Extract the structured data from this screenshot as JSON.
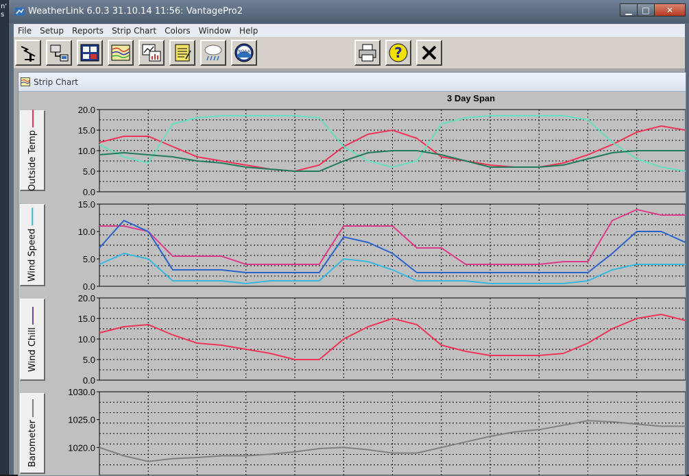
{
  "window": {
    "title": "WeatherLink 6.0.3  31.10.14  11:56: VantagePro2",
    "controls": {
      "minimize": "▁",
      "maximize": "□",
      "close": "✕"
    }
  },
  "desktop": {
    "fragment_text": [
      "n'",
      "s"
    ]
  },
  "menu": [
    "File",
    "Setup",
    "Reports",
    "Strip Chart",
    "Colors",
    "Window",
    "Help"
  ],
  "toolbar": {
    "buttons": [
      {
        "name": "connect-station-icon"
      },
      {
        "name": "download-icon"
      },
      {
        "name": "bulletin-icon"
      },
      {
        "name": "strip-chart-icon"
      },
      {
        "name": "plot-icon"
      },
      {
        "name": "notepad-icon"
      },
      {
        "name": "weather-cloud-icon"
      },
      {
        "name": "noaa-icon",
        "text": "NOAA"
      },
      {
        "name": "print-icon"
      },
      {
        "name": "help-icon",
        "text": "?"
      },
      {
        "name": "close-chart-icon"
      }
    ]
  },
  "child_window": {
    "title": "Strip Chart"
  },
  "chart_data": [
    {
      "type": "line",
      "title": "3 Day Span",
      "ylabel": "Outside Temp",
      "ylim": [
        0,
        20
      ],
      "yticks": [
        "0.0",
        "5.0",
        "10.0",
        "15.0",
        "20.0"
      ],
      "x": [
        0,
        3,
        6,
        9,
        12,
        15,
        18,
        21,
        24,
        27,
        30,
        33,
        36,
        39,
        42,
        45,
        48,
        51,
        54,
        57,
        60,
        63,
        66,
        69,
        72
      ],
      "series": [
        {
          "color": "#ee3355",
          "values": [
            12,
            13.5,
            13.5,
            11,
            8.5,
            7.5,
            6.5,
            5.5,
            5,
            6.5,
            11,
            14,
            15,
            13,
            8.5,
            7.5,
            6.5,
            6,
            6,
            7,
            9,
            11.5,
            14.5,
            16,
            15
          ]
        },
        {
          "color": "#66e0c0",
          "values": [
            11.5,
            8.5,
            7,
            16.5,
            18,
            18.5,
            18.5,
            18.5,
            18.5,
            18,
            11,
            7.5,
            6,
            7.5,
            16.5,
            18,
            18.5,
            18.5,
            18.5,
            18.5,
            17.5,
            12,
            8,
            6,
            5
          ]
        },
        {
          "color": "#207a5c",
          "values": [
            9,
            9.5,
            9,
            8.5,
            7.5,
            7,
            6,
            5.5,
            5,
            5,
            7.5,
            9.5,
            10,
            10,
            9,
            7.5,
            6,
            6,
            6,
            6.5,
            8,
            9.5,
            10,
            10,
            10
          ]
        }
      ]
    },
    {
      "type": "line",
      "ylabel": "Wind Speed",
      "ylim": [
        0,
        15
      ],
      "yticks": [
        "0.0",
        "5.0",
        "10.0",
        "15.0"
      ],
      "x": [
        0,
        3,
        6,
        9,
        12,
        15,
        18,
        21,
        24,
        27,
        30,
        33,
        36,
        39,
        42,
        45,
        48,
        51,
        54,
        57,
        60,
        63,
        66,
        69,
        72
      ],
      "series": [
        {
          "color": "#dd3a8a",
          "values": [
            11,
            11,
            10,
            5.5,
            5.5,
            5.5,
            4,
            4,
            4,
            4,
            11,
            11,
            11,
            7,
            7,
            4,
            4,
            4,
            4,
            4.5,
            4.5,
            12,
            14,
            13,
            13
          ]
        },
        {
          "color": "#2a62cc",
          "values": [
            7,
            12,
            10,
            3,
            3,
            3,
            2.5,
            2.5,
            2.5,
            2.5,
            9,
            8,
            6,
            2.5,
            2.5,
            2.5,
            2.5,
            2.5,
            2.5,
            2.5,
            2.5,
            6,
            10,
            10,
            8
          ]
        },
        {
          "color": "#38b8e0",
          "values": [
            4,
            6,
            5,
            1,
            1,
            1,
            0.5,
            1,
            1,
            1,
            5,
            4.5,
            3,
            1,
            1,
            1,
            0.5,
            0.5,
            0.5,
            0.5,
            1,
            3,
            4,
            4,
            4
          ]
        }
      ]
    },
    {
      "type": "line",
      "ylabel": "Wind Chill",
      "ylim": [
        0,
        20
      ],
      "yticks": [
        "0.0",
        "5.0",
        "10.0",
        "15.0",
        "20.0"
      ],
      "x": [
        0,
        3,
        6,
        9,
        12,
        15,
        18,
        21,
        24,
        27,
        30,
        33,
        36,
        39,
        42,
        45,
        48,
        51,
        54,
        57,
        60,
        63,
        66,
        69,
        72
      ],
      "series": [
        {
          "color": "#ee3355",
          "values": [
            11.5,
            13,
            13.5,
            11,
            9,
            8.5,
            7.5,
            6.5,
            5,
            5,
            10,
            13,
            15,
            13.5,
            8.5,
            7,
            6,
            6,
            6,
            6.5,
            9,
            12.5,
            15,
            16,
            14.5
          ]
        }
      ]
    },
    {
      "type": "line",
      "ylabel": "Barometer",
      "ylim": [
        1015,
        1030
      ],
      "yticks": [
        "1020.0",
        "1025.0",
        "1030.0"
      ],
      "x": [
        0,
        3,
        6,
        9,
        12,
        15,
        18,
        21,
        24,
        27,
        30,
        33,
        36,
        39,
        42,
        45,
        48,
        51,
        54,
        57,
        60,
        63,
        66,
        69,
        72
      ],
      "series": [
        {
          "color": "#808080",
          "values": [
            1020,
            1018.5,
            1017.5,
            1018,
            1018.2,
            1018.5,
            1018.5,
            1018.8,
            1019.2,
            1019.8,
            1020,
            1019.6,
            1019,
            1019,
            1020,
            1021,
            1022,
            1022.8,
            1023.2,
            1024,
            1024.8,
            1024.6,
            1024.2,
            1023.8,
            1023.8
          ]
        }
      ]
    }
  ],
  "side_tabs": [
    {
      "label": "Outside Temp",
      "color": "#ee3355"
    },
    {
      "label": "Wind Speed",
      "color": "#38b8e0"
    },
    {
      "label": "Wind Chill",
      "color": "#7a3fa0"
    },
    {
      "label": "Barometer",
      "color": "#808080"
    }
  ]
}
